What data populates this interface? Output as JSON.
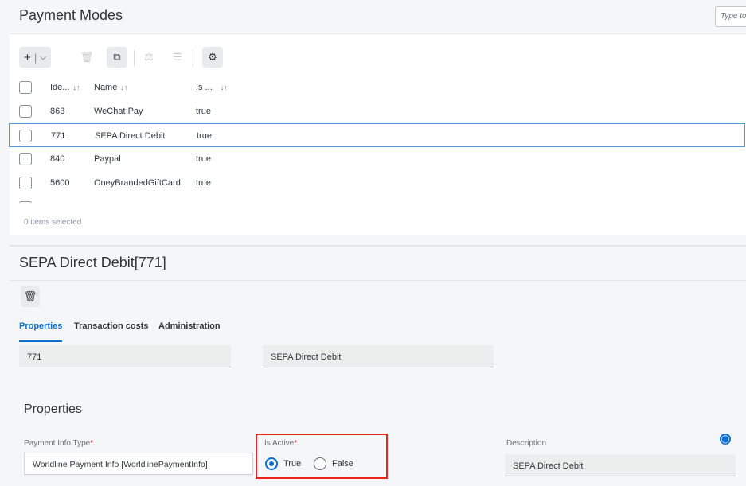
{
  "header": {
    "title": "Payment Modes",
    "search_placeholder": "Type to search"
  },
  "toolbar": {
    "add_label": "+",
    "dropdown_label": "⌄"
  },
  "table": {
    "columns": [
      "Ide...",
      "Name",
      "Is ..."
    ],
    "rows": [
      {
        "id": "863",
        "name": "WeChat Pay",
        "active": "true"
      },
      {
        "id": "771",
        "name": "SEPA Direct Debit",
        "active": "true"
      },
      {
        "id": "840",
        "name": "Paypal",
        "active": "true"
      },
      {
        "id": "5600",
        "name": "OneyBrandedGiftCard",
        "active": "true"
      }
    ],
    "selected_count_text": "0 items selected"
  },
  "detail": {
    "title": "SEPA Direct Debit[771]",
    "tabs": [
      "Properties",
      "Transaction costs",
      "Administration"
    ],
    "code_value": "771",
    "name_value": "SEPA Direct Debit",
    "section_title": "Properties",
    "payment_info_type_label": "Payment Info Type",
    "payment_info_type_value": "Worldline Payment Info [WorldlinePaymentInfo]",
    "is_active_label": "Is Active",
    "radio_true_label": "True",
    "radio_false_label": "False",
    "description_label": "Description",
    "description_value": "SEPA Direct Debit",
    "required_marker": "*"
  },
  "colors": {
    "accent": "#0a6ed1",
    "highlight": "#e8231b"
  }
}
